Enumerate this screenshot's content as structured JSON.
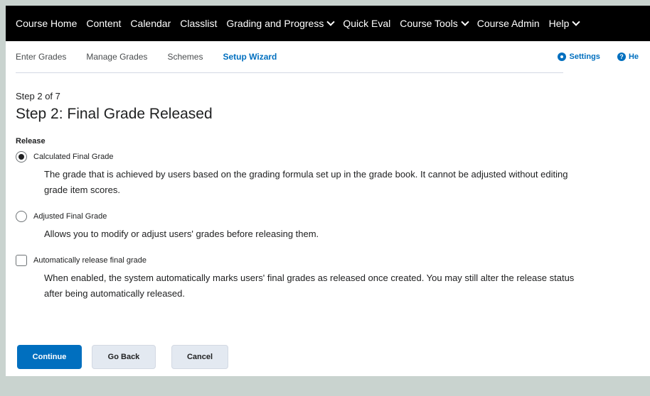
{
  "topnav": {
    "items": [
      {
        "label": "Course Home",
        "dropdown": false
      },
      {
        "label": "Content",
        "dropdown": false
      },
      {
        "label": "Calendar",
        "dropdown": false
      },
      {
        "label": "Classlist",
        "dropdown": false
      },
      {
        "label": "Grading and Progress",
        "dropdown": true
      },
      {
        "label": "Quick Eval",
        "dropdown": false
      },
      {
        "label": "Course Tools",
        "dropdown": true
      },
      {
        "label": "Course Admin",
        "dropdown": false
      },
      {
        "label": "Help",
        "dropdown": true
      }
    ]
  },
  "subnav": {
    "tabs": [
      "Enter Grades",
      "Manage Grades",
      "Schemes",
      "Setup Wizard"
    ],
    "active_tab": "Setup Wizard",
    "settings_label": "Settings",
    "help_label": "He"
  },
  "wizard": {
    "step_label": "Step 2 of 7",
    "title": "Step 2: Final Grade Released",
    "section_label": "Release",
    "options": [
      {
        "label": "Calculated Final Grade",
        "selected": true,
        "description_lines": [
          "The grade that is achieved by users based on the grading formula set up in the grade book. It cannot be adjusted without editing",
          "grade item scores."
        ]
      },
      {
        "label": "Adjusted Final Grade",
        "selected": false,
        "description_lines": [
          "Allows you to modify or adjust users' grades before releasing them."
        ]
      }
    ],
    "auto_release": {
      "label": "Automatically release final grade",
      "checked": false,
      "description_lines": [
        "When enabled, the system automatically marks users' final grades as released once created. You may still alter the release status",
        "after being automatically released."
      ]
    }
  },
  "buttons": {
    "continue_label": "Continue",
    "go_back_label": "Go Back",
    "cancel_label": "Cancel"
  },
  "colors": {
    "primary": "#006fbf",
    "nav_background": "#000000",
    "outer_background": "#c9d3cf"
  }
}
